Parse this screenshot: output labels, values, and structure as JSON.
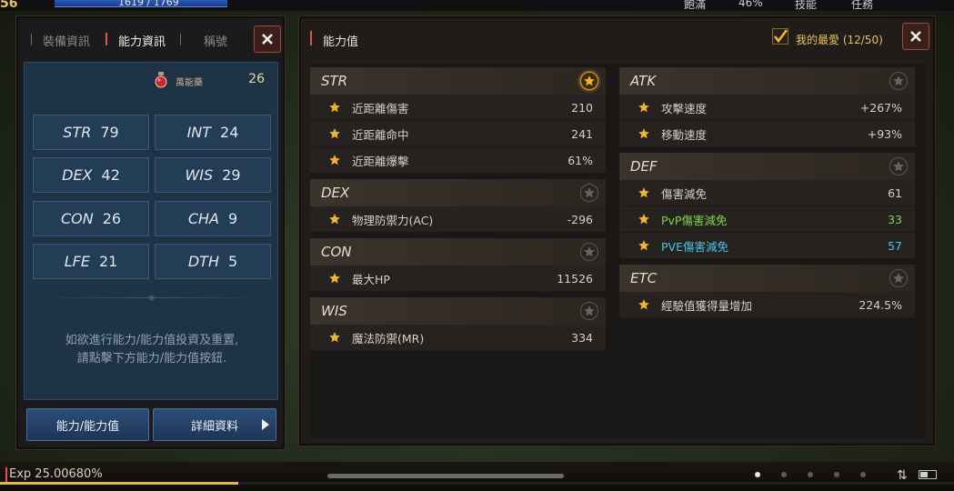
{
  "hud": {
    "level": "56",
    "hp_text": "1619 / 1769",
    "top_right": [
      "飽滿",
      "46%",
      "技能",
      "任務"
    ],
    "exp_label": "Exp 25.00680%",
    "exp_progress": 0.25,
    "page_count": 5,
    "active_page": 0,
    "battery_level": 0.5
  },
  "left_panel": {
    "tabs": [
      "裝備資訊",
      "能力資訊",
      "稱號"
    ],
    "active_tab": 1,
    "potion_label": "萬能藥",
    "potion_count": "26",
    "stats": [
      {
        "name": "STR",
        "value": "79"
      },
      {
        "name": "INT",
        "value": "24"
      },
      {
        "name": "DEX",
        "value": "42"
      },
      {
        "name": "WIS",
        "value": "29"
      },
      {
        "name": "CON",
        "value": "26"
      },
      {
        "name": "CHA",
        "value": "9"
      },
      {
        "name": "LFE",
        "value": "21"
      },
      {
        "name": "DTH",
        "value": "5"
      }
    ],
    "hint_line1": "如欲進行能力/能力值投資及重置,",
    "hint_line2": "請點擊下方能力/能力值按鈕.",
    "btn_ability": "能力/能力值",
    "btn_details": "詳細資料"
  },
  "right_panel": {
    "title": "能力值",
    "favorite_label": "我的最愛 (12/50)",
    "groups_left": [
      {
        "name": "STR",
        "favorite": true,
        "rows": [
          {
            "label": "近距離傷害",
            "value": "210"
          },
          {
            "label": "近距離命中",
            "value": "241"
          },
          {
            "label": "近距離爆擊",
            "value": "61%"
          }
        ]
      },
      {
        "name": "DEX",
        "favorite": false,
        "rows": [
          {
            "label": "物理防禦力(AC)",
            "value": "-296"
          }
        ]
      },
      {
        "name": "CON",
        "favorite": false,
        "rows": [
          {
            "label": "最大HP",
            "value": "11526"
          }
        ]
      },
      {
        "name": "WIS",
        "favorite": false,
        "rows": [
          {
            "label": "魔法防禦(MR)",
            "value": "334"
          }
        ]
      }
    ],
    "groups_right": [
      {
        "name": "ATK",
        "favorite": false,
        "rows": [
          {
            "label": "攻擊速度",
            "value": "+267%"
          },
          {
            "label": "移動速度",
            "value": "+93%"
          }
        ]
      },
      {
        "name": "DEF",
        "favorite": false,
        "rows": [
          {
            "label": "傷害減免",
            "value": "61"
          },
          {
            "label": "PvP傷害減免",
            "value": "33",
            "color": "#7fd64a"
          },
          {
            "label": "PVE傷害減免",
            "value": "57",
            "color": "#4cc4e8"
          }
        ]
      },
      {
        "name": "ETC",
        "favorite": false,
        "rows": [
          {
            "label": "經驗值獲得量增加",
            "value": "224.5%"
          }
        ]
      }
    ]
  }
}
